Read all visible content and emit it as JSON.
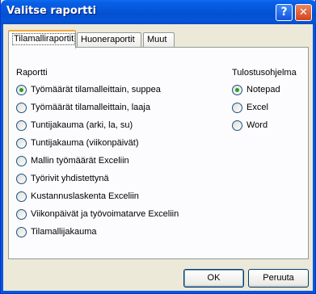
{
  "window": {
    "title": "Valitse raportti"
  },
  "titlebar": {
    "help_glyph": "?",
    "close_glyph": "✕"
  },
  "tabs": [
    {
      "label": "Tilamalliraportit",
      "active": true
    },
    {
      "label": "Huoneraportit",
      "active": false
    },
    {
      "label": "Muut",
      "active": false
    }
  ],
  "report_group": {
    "label": "Raportti",
    "options": [
      {
        "label": "Työmäärät tilamalleittain, suppea",
        "checked": true
      },
      {
        "label": "Työmäärät tilamalleittain, laaja",
        "checked": false
      },
      {
        "label": "Tuntijakauma (arki, la, su)",
        "checked": false
      },
      {
        "label": "Tuntijakauma (viikonpäivät)",
        "checked": false
      },
      {
        "label": "Mallin työmäärät Exceliin",
        "checked": false
      },
      {
        "label": "Työrivit yhdistettynä",
        "checked": false
      },
      {
        "label": "Kustannuslaskenta Exceliin",
        "checked": false
      },
      {
        "label": "Viikonpäivät ja työvoimatarve Exceliin",
        "checked": false
      },
      {
        "label": "Tilamallijakauma",
        "checked": false
      }
    ]
  },
  "output_group": {
    "label": "Tulostusohjelma",
    "options": [
      {
        "label": "Notepad",
        "checked": true
      },
      {
        "label": "Excel",
        "checked": false
      },
      {
        "label": "Word",
        "checked": false
      }
    ]
  },
  "buttons": {
    "ok": "OK",
    "cancel": "Peruuta"
  }
}
